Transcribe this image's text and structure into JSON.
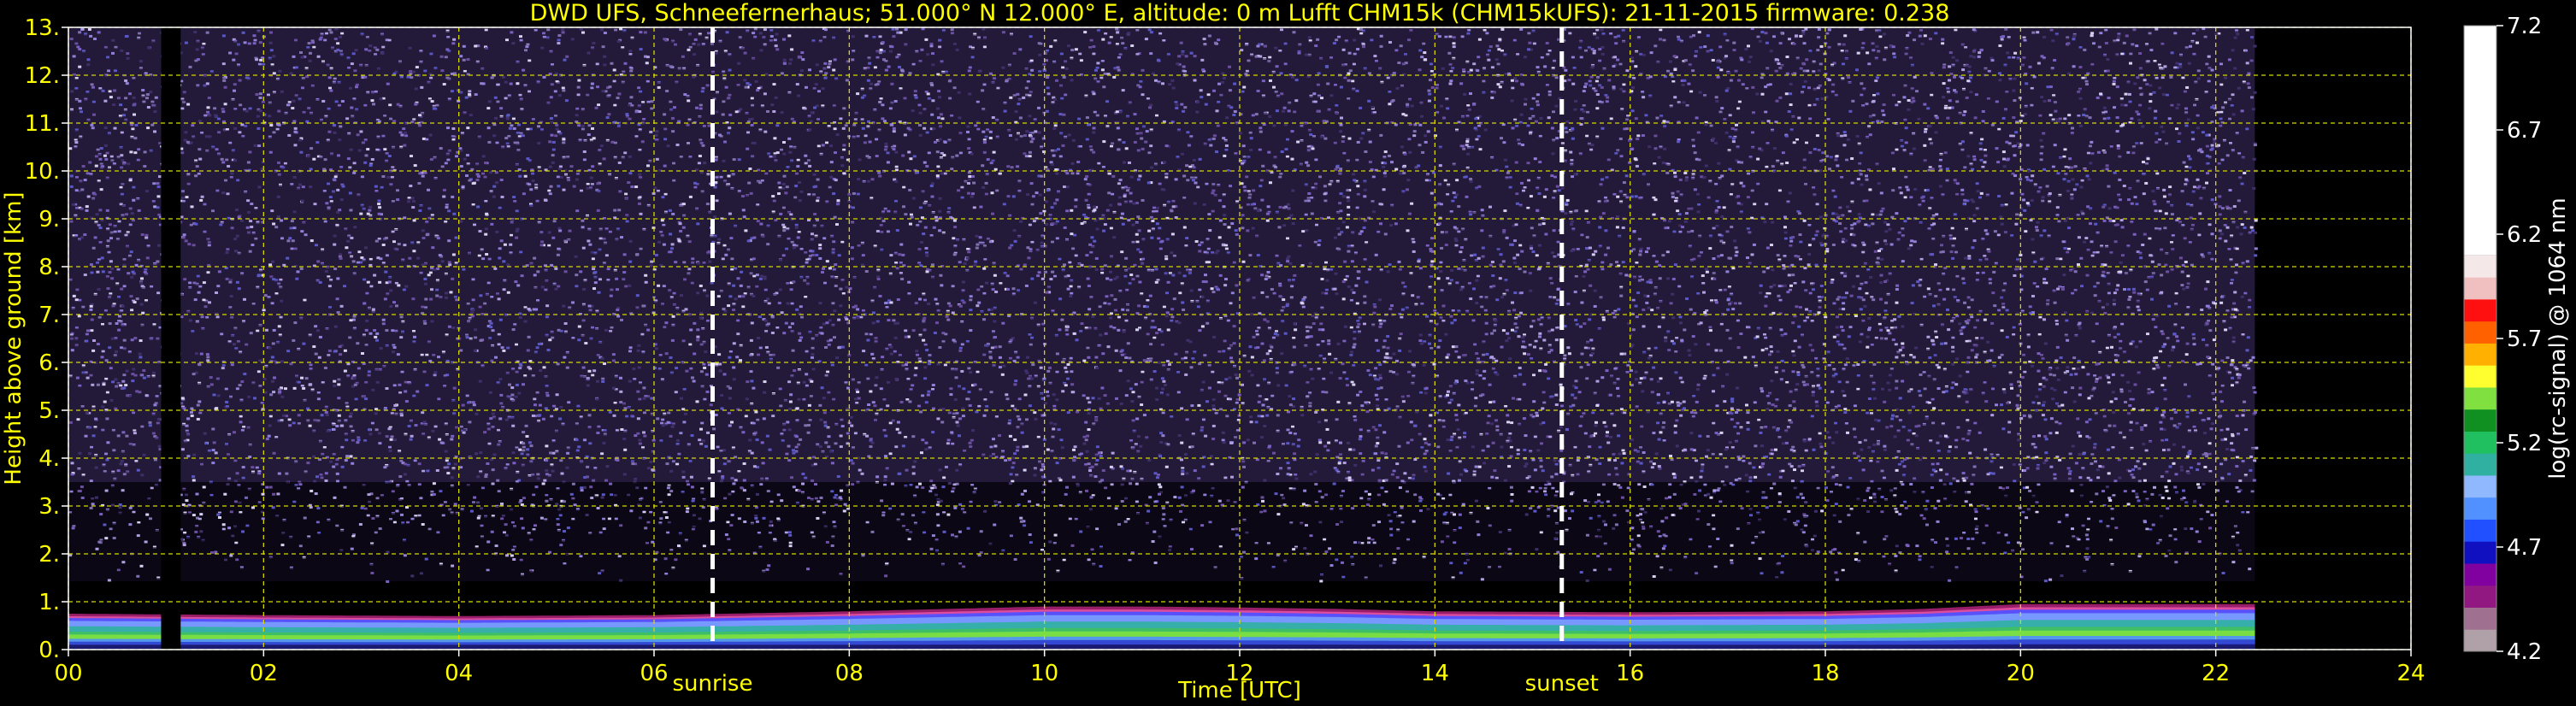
{
  "title": "DWD UFS, Schneefernerhaus; 51.000° N 12.000° E, altitude: 0 m    Lufft CHM15k (CHM15kUFS): 21-11-2015    firmware: 0.238",
  "chart_data": {
    "type": "heatmap",
    "xlabel": "Time [UTC]",
    "ylabel": "Height above ground [km]",
    "xlim": [
      0,
      24
    ],
    "ylim": [
      0,
      13
    ],
    "x_ticks": [
      "00",
      "02",
      "04",
      "06",
      "08",
      "10",
      "12",
      "14",
      "16",
      "18",
      "20",
      "22",
      "24"
    ],
    "y_ticks": [
      "0.",
      "1.",
      "2.",
      "3.",
      "4.",
      "5.",
      "6.",
      "7.",
      "8.",
      "9.",
      "10.",
      "11.",
      "12.",
      "13."
    ],
    "grid": true,
    "data_end_hour": 22.4,
    "data_gap": [
      0.95,
      1.15
    ],
    "events": [
      {
        "label": "sunrise",
        "x": 6.6
      },
      {
        "label": "sunset",
        "x": 15.3
      }
    ],
    "boundary_layer_top_km": [
      [
        0,
        0.75
      ],
      [
        2,
        0.72
      ],
      [
        4,
        0.7
      ],
      [
        6,
        0.72
      ],
      [
        8,
        0.8
      ],
      [
        9,
        0.85
      ],
      [
        10,
        0.9
      ],
      [
        11,
        0.9
      ],
      [
        12,
        0.88
      ],
      [
        13,
        0.85
      ],
      [
        14,
        0.8
      ],
      [
        16,
        0.78
      ],
      [
        18,
        0.8
      ],
      [
        19,
        0.85
      ],
      [
        20,
        0.95
      ],
      [
        21,
        0.95
      ],
      [
        22.4,
        0.95
      ]
    ],
    "colorbar": {
      "label": "log(rc-signal) @ 1064 nm",
      "range": [
        4.2,
        7.2
      ],
      "ticks": [
        "4.2",
        "4.7",
        "5.2",
        "5.7",
        "6.2",
        "6.7",
        "7.2"
      ],
      "colors": [
        "#b0a0a8",
        "#a07090",
        "#901880",
        "#8000a0",
        "#1010c0",
        "#2050ff",
        "#5090ff",
        "#90b8ff",
        "#30b0a0",
        "#20c060",
        "#109020",
        "#80e040",
        "#ffff30",
        "#ffb000",
        "#ff6000",
        "#ff1010",
        "#f0c0c0",
        "#f5e8e8",
        "#ffffff"
      ]
    }
  }
}
